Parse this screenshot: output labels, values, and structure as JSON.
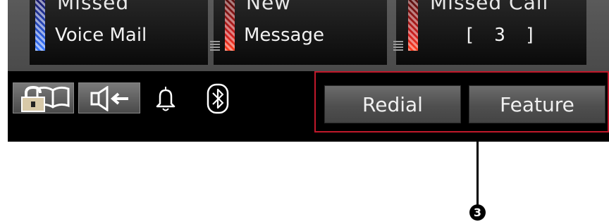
{
  "status_tiles": [
    {
      "top_text": "Missed",
      "label": "Voice Mail",
      "stripe": "blue"
    },
    {
      "top_text": "New",
      "label": "Message",
      "stripe": "red"
    },
    {
      "top_text": "Missed Call",
      "label": "[ 3 ]",
      "stripe": "red"
    }
  ],
  "toolbar": {
    "icons": [
      "unlocked-directory-icon",
      "speaker-mute-icon",
      "bell-icon",
      "bluetooth-icon"
    ],
    "redial_label": "Redial",
    "feature_label": "Feature"
  },
  "callout": {
    "number": "3"
  },
  "colors": {
    "highlight": "#c0182a",
    "stripe_blue": "#2a5ad8",
    "stripe_red": "#d02020"
  }
}
